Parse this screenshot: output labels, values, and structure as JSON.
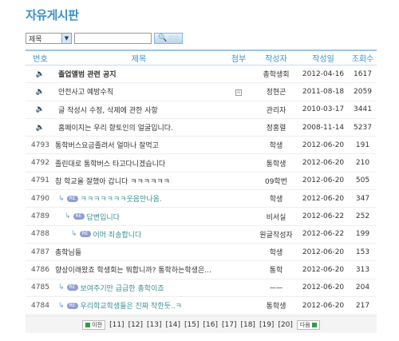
{
  "page_title": "자유게시판",
  "search": {
    "select_value": "제목",
    "select_arrow_icon": "chevron-down-icon",
    "input_value": "",
    "button_label": "검색",
    "button_icon": "search-icon"
  },
  "headers": {
    "num": "번호",
    "title": "제목",
    "attachment": "첨부",
    "author": "작성자",
    "date": "작성일",
    "views": "조회수"
  },
  "rows": [
    {
      "num": "",
      "notice": true,
      "title": "졸업앨범 관련 공지",
      "bold": true,
      "attach": false,
      "author": "총학생회",
      "date": "2012-04-16",
      "views": "1617"
    },
    {
      "num": "",
      "notice": true,
      "title": "안전사고 예방수칙",
      "bold": false,
      "attach": true,
      "author": "정현곤",
      "date": "2011-08-18",
      "views": "2059"
    },
    {
      "num": "",
      "notice": true,
      "title": "글 작성시 수정, 삭제에 관한 사항",
      "bold": false,
      "attach": false,
      "author": "관리자",
      "date": "2010-03-17",
      "views": "3441"
    },
    {
      "num": "",
      "notice": true,
      "title": "홈페이지는 우리 향토인의 얼굴입니다.",
      "bold": false,
      "attach": false,
      "author": "정홍렬",
      "date": "2008-11-14",
      "views": "5237"
    },
    {
      "num": "4793",
      "notice": false,
      "title": "통학버스요금졸려서 얼마나 잘먹고",
      "attach": false,
      "author": "학생",
      "date": "2012-06-20",
      "views": "191"
    },
    {
      "num": "4792",
      "notice": false,
      "title": "졸린대로 통학버스 타고다니겠습니다",
      "attach": false,
      "author": "통학생",
      "date": "2012-06-20",
      "views": "210"
    },
    {
      "num": "4791",
      "notice": false,
      "title": "참 학교올 잘했아 갑니다 ㅋㅋㅋㅋㅋㅋ",
      "attach": false,
      "author": "09학번",
      "date": "2012-06-20",
      "views": "505"
    },
    {
      "num": "4790",
      "notice": false,
      "reply": true,
      "indent": 0,
      "title": "ㅋㅋㅋㅋㅋㅋㅋ웃음만나옴.",
      "teal": true,
      "attach": false,
      "author": "학생",
      "date": "2012-06-20",
      "views": "347"
    },
    {
      "num": "4789",
      "notice": false,
      "reply": true,
      "indent": 1,
      "title": "답변입니다",
      "teal": true,
      "attach": false,
      "author": "비서실",
      "date": "2012-06-22",
      "views": "252"
    },
    {
      "num": "4788",
      "notice": false,
      "reply": true,
      "indent": 2,
      "title": "어머 죄송합니다",
      "teal": true,
      "attach": false,
      "author": "원글작성자",
      "date": "2012-06-22",
      "views": "199"
    },
    {
      "num": "4787",
      "notice": false,
      "title": "총학님들",
      "attach": false,
      "author": "학생",
      "date": "2012-06-20",
      "views": "153"
    },
    {
      "num": "4786",
      "notice": false,
      "title": "향상이래왔죠 학생회는 뭐합니까? 통학하는학생은...",
      "attach": false,
      "author": "통학",
      "date": "2012-06-20",
      "views": "313"
    },
    {
      "num": "4785",
      "notice": false,
      "reply": true,
      "indent": 0,
      "title": "보여주기만 급급한 총학이죠",
      "teal": true,
      "attach": false,
      "author": "ㅡㅡ",
      "date": "2012-06-20",
      "views": "204"
    },
    {
      "num": "4784",
      "notice": false,
      "reply": true,
      "indent": 0,
      "title": "우리학교학생들은 진짜 착한듯..ㅋ",
      "teal": true,
      "attach": false,
      "author": "통학생",
      "date": "2012-06-20",
      "views": "217"
    }
  ],
  "reply_badge": "RE",
  "reply_arrow": "↳",
  "notice_icon": "speaker-icon",
  "attachment_icon": "attachment-icon",
  "pagination": {
    "prev_label": "이전",
    "next_label": "다음",
    "pages": [
      "[11]",
      "[12]",
      "[13]",
      "[14]",
      "[15]",
      "[16]",
      "[17]",
      "[18]",
      "[19]",
      "[20]"
    ]
  }
}
